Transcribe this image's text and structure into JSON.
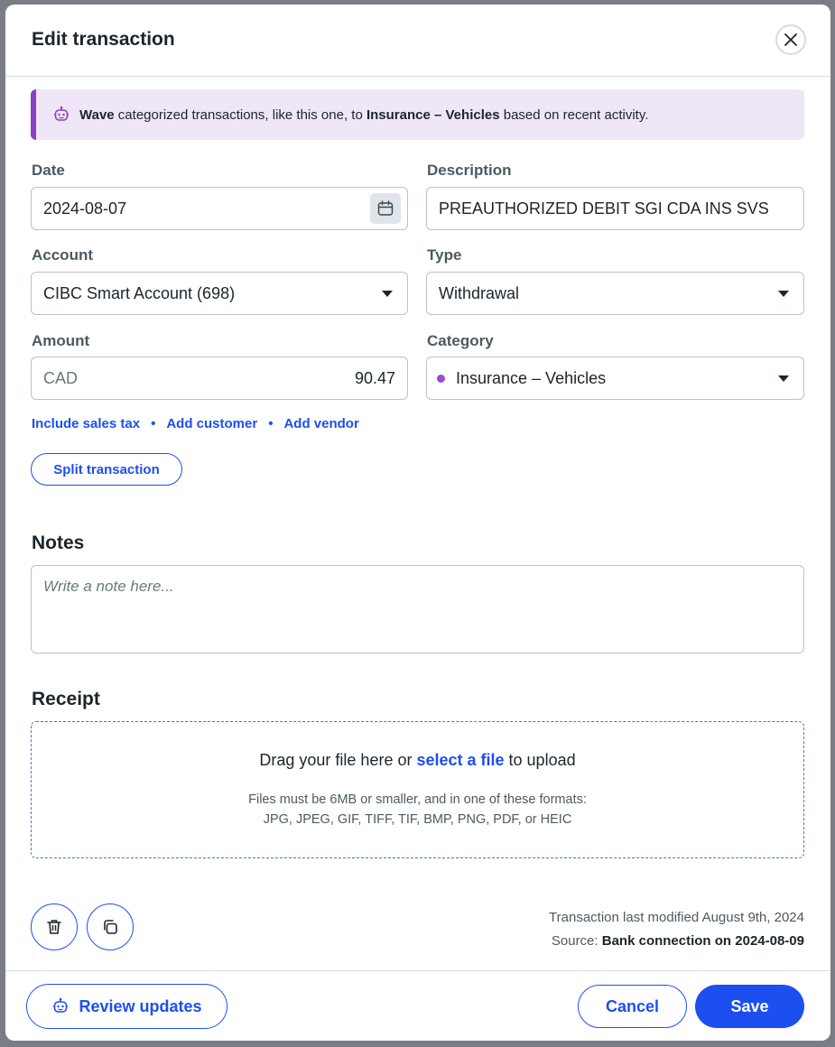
{
  "dialog": {
    "title": "Edit transaction"
  },
  "banner": {
    "brand": "Wave",
    "text_before": " categorized transactions, like this one, to ",
    "category": "Insurance – Vehicles",
    "text_after": " based on recent activity.",
    "icon": "robot-icon"
  },
  "form": {
    "date": {
      "label": "Date",
      "value": "2024-08-07",
      "icon": "calendar-icon"
    },
    "description": {
      "label": "Description",
      "value": "PREAUTHORIZED DEBIT SGI CDA INS SVS"
    },
    "account": {
      "label": "Account",
      "value": "CIBC Smart Account (698)"
    },
    "type": {
      "label": "Type",
      "value": "Withdrawal"
    },
    "amount": {
      "label": "Amount",
      "currency": "CAD",
      "value": "90.47"
    },
    "category": {
      "label": "Category",
      "value": "Insurance – Vehicles",
      "dot_color": "#9d4bd1"
    }
  },
  "links": {
    "sales_tax": "Include sales tax",
    "add_customer": "Add customer",
    "add_vendor": "Add vendor",
    "separator": "•"
  },
  "split_button": "Split transaction",
  "notes": {
    "title": "Notes",
    "placeholder": "Write a note here..."
  },
  "receipt": {
    "title": "Receipt",
    "drag_prefix": "Drag your file here or ",
    "select_link": "select a file",
    "drag_suffix": " to upload",
    "requirements_line1": "Files must be 6MB or smaller, and in one of these formats:",
    "requirements_line2": "JPG, JPEG, GIF, TIFF, TIF, BMP, PNG, PDF, or HEIC"
  },
  "meta": {
    "modified": "Transaction last modified August 9th, 2024",
    "source_label": "Source: ",
    "source_value": "Bank connection on 2024-08-09"
  },
  "footer": {
    "review_label": "Review updates",
    "cancel_label": "Cancel",
    "save_label": "Save"
  },
  "colors": {
    "accent": "#1c4ff0",
    "banner_bg": "#efe6f8",
    "banner_border": "#8b3fc9"
  }
}
